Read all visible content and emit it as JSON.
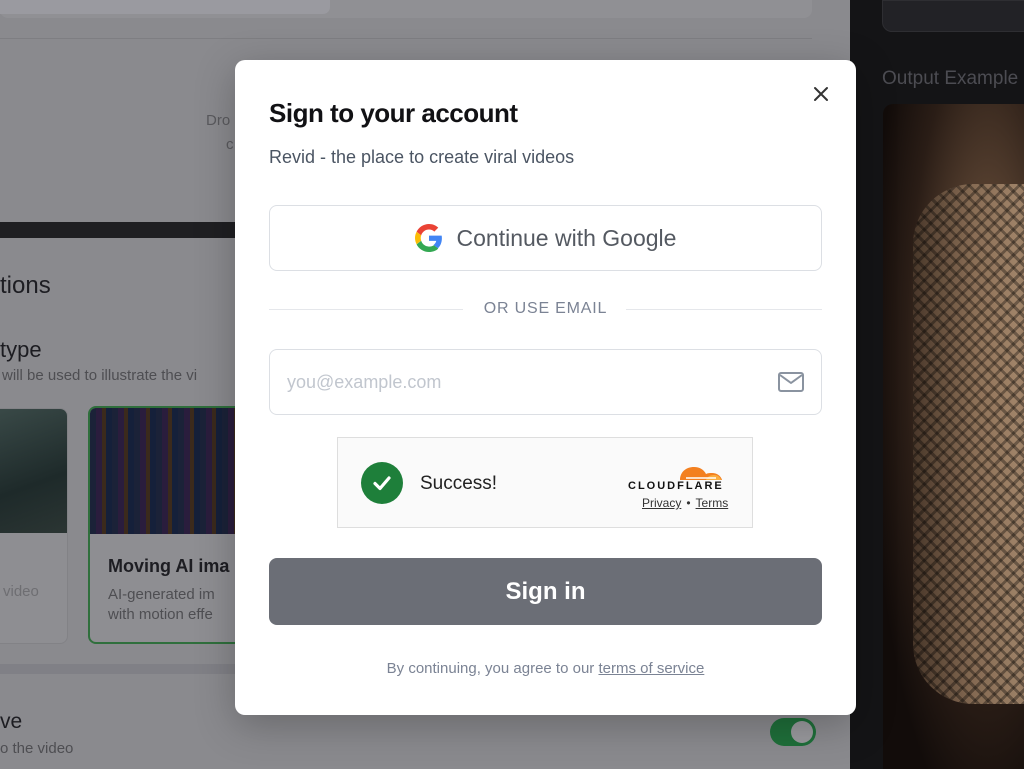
{
  "background": {
    "drop_text_1": "Dro",
    "drop_text_2": "c",
    "section_heading": "tions",
    "media_type_heading": "type",
    "media_type_desc": "will be used to illustrate the vi",
    "card1_caption": "video",
    "card2_title": "Moving AI ima",
    "card2_desc_1": "AI-generated im",
    "card2_desc_2": "with motion effe",
    "bottom_heading": "ve",
    "bottom_desc": "o the video",
    "right_panel_label": "Output Example"
  },
  "modal": {
    "title": "Sign to your account",
    "subtitle": "Revid - the place to create viral videos",
    "google_button_label": "Continue with Google",
    "divider_text": "OR USE EMAIL",
    "email_placeholder": "you@example.com",
    "email_value": "",
    "captcha": {
      "status_text": "Success!",
      "brand": "CLOUDFLARE",
      "privacy_label": "Privacy",
      "separator": "•",
      "terms_label": "Terms"
    },
    "signin_button_label": "Sign in",
    "terms_prefix": "By continuing, you agree to our",
    "terms_link": "terms of service"
  },
  "colors": {
    "signin_button": "#6b6e76",
    "success_green": "#1e7f3a",
    "cloudflare_orange": "#f38020",
    "toggle_on": "#1f6f3a"
  },
  "icons": {
    "close": "close-icon",
    "google": "google-g-icon",
    "mail": "mail-icon",
    "check": "check-icon",
    "cloudflare": "cloudflare-logo-icon"
  }
}
